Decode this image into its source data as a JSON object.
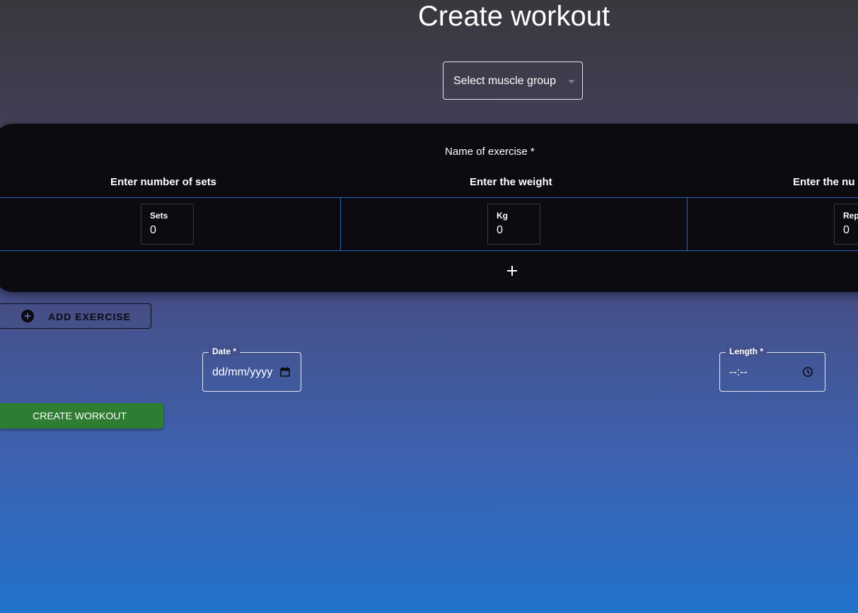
{
  "page": {
    "title": "Create workout"
  },
  "muscle_group_select": {
    "value": "Select muscle group",
    "icon": "chevron-down-icon"
  },
  "exercise_card": {
    "name_label": "Name of exercise *",
    "columns": [
      {
        "header": "Enter number of sets",
        "field_label": "Sets",
        "value": "0"
      },
      {
        "header": "Enter the weight",
        "field_label": "Kg",
        "value": "0"
      },
      {
        "header": "Enter the nu",
        "field_label": "Rep",
        "value": "0"
      }
    ],
    "add_set_icon": "plus-icon"
  },
  "add_exercise_button": {
    "label": "ADD EXERCISE",
    "icon": "add-circle-icon"
  },
  "date_field": {
    "label": "Date *",
    "value": "dd/mm/yyyy",
    "icon": "calendar-icon"
  },
  "length_field": {
    "label": "Length *",
    "value": "--:--",
    "icon": "clock-icon"
  },
  "create_workout_button": {
    "label": "CREATE WORKOUT",
    "color": "#2e7d32"
  },
  "colors": {
    "grid_line": "#2a63c4",
    "card_background": "#0b0b10"
  }
}
